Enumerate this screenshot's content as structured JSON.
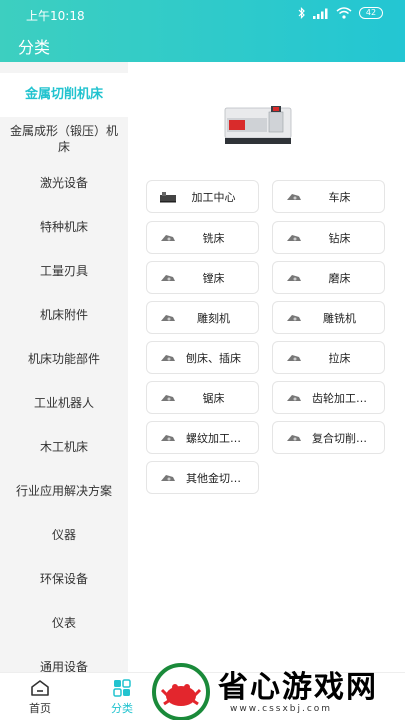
{
  "status": {
    "time": "上午10:18",
    "battery": "42"
  },
  "header": {
    "title": "分类"
  },
  "sidebar": {
    "items": [
      {
        "label": "金属切削机床",
        "active": true
      },
      {
        "label": "金属成形（锻压）机床"
      },
      {
        "label": "激光设备"
      },
      {
        "label": "特种机床"
      },
      {
        "label": "工量刃具"
      },
      {
        "label": "机床附件"
      },
      {
        "label": "机床功能部件"
      },
      {
        "label": "工业机器人"
      },
      {
        "label": "木工机床"
      },
      {
        "label": "行业应用解决方案"
      },
      {
        "label": "仪器"
      },
      {
        "label": "环保设备"
      },
      {
        "label": "仪表"
      },
      {
        "label": "通用设备"
      }
    ]
  },
  "content": {
    "banner_icon": "cnc-machine-image",
    "tiles": [
      {
        "label": "加工中心",
        "icon": "machining-center-icon"
      },
      {
        "label": "车床",
        "icon": "lathe-icon"
      },
      {
        "label": "铣床",
        "icon": "milling-icon"
      },
      {
        "label": "钻床",
        "icon": "drilling-icon"
      },
      {
        "label": "镗床",
        "icon": "boring-icon"
      },
      {
        "label": "磨床",
        "icon": "grinding-icon"
      },
      {
        "label": "雕刻机",
        "icon": "engraving-icon"
      },
      {
        "label": "雕铣机",
        "icon": "engrave-mill-icon"
      },
      {
        "label": "刨床、插床",
        "icon": "planer-icon"
      },
      {
        "label": "拉床",
        "icon": "broaching-icon"
      },
      {
        "label": "锯床",
        "icon": "sawing-icon"
      },
      {
        "label": "齿轮加工…",
        "icon": "gear-machine-icon"
      },
      {
        "label": "螺纹加工…",
        "icon": "thread-machine-icon"
      },
      {
        "label": "复合切削…",
        "icon": "compound-cutting-icon"
      },
      {
        "label": "其他金切…",
        "icon": "other-metal-cutting-icon"
      }
    ]
  },
  "tabbar": {
    "items": [
      {
        "label": "首页",
        "icon": "home-icon"
      },
      {
        "label": "分类",
        "icon": "category-icon",
        "active": true
      }
    ]
  },
  "watermark": {
    "title": "省心游戏网",
    "url": "www.cssxbj.com"
  },
  "colors": {
    "accent": "#22c3cf",
    "header_gradient_start": "#3dcfc0",
    "sidebar_bg": "#f4f4f4"
  }
}
